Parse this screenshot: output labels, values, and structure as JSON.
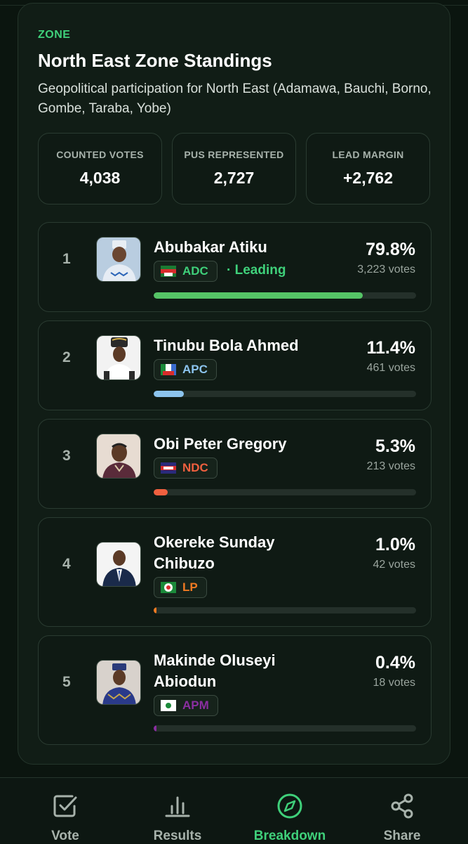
{
  "zone": {
    "tag": "ZONE",
    "title": "North East Zone Standings",
    "description": "Geopolitical participation for North East (Adamawa, Bauchi, Borno, Gombe, Taraba, Yobe)"
  },
  "stats": [
    {
      "label": "COUNTED VOTES",
      "value": "4,038"
    },
    {
      "label": "PUS REPRESENTED",
      "value": "2,727"
    },
    {
      "label": "LEAD MARGIN",
      "value": "+2,762"
    }
  ],
  "candidates": [
    {
      "rank": "1",
      "name": "Abubakar Atiku",
      "party": "ADC",
      "party_color": "#3fd07a",
      "status": "· Leading",
      "percent": "79.8%",
      "votes": "3,223 votes",
      "share": 0.798,
      "bar_color": "#55c466"
    },
    {
      "rank": "2",
      "name": "Tinubu Bola Ahmed",
      "party": "APC",
      "party_color": "#8cc4ee",
      "status": "",
      "percent": "11.4%",
      "votes": "461 votes",
      "share": 0.114,
      "bar_color": "#8cc4ee"
    },
    {
      "rank": "3",
      "name": "Obi Peter Gregory",
      "party": "NDC",
      "party_color": "#f1603f",
      "status": "",
      "percent": "5.3%",
      "votes": "213 votes",
      "share": 0.053,
      "bar_color": "#f1603f"
    },
    {
      "rank": "4",
      "name": "Okereke Sunday Chibuzo",
      "party": "LP",
      "party_color": "#f07a22",
      "status": "",
      "percent": "1.0%",
      "votes": "42 votes",
      "share": 0.01,
      "bar_color": "#f07a22"
    },
    {
      "rank": "5",
      "name": "Makinde Oluseyi Abiodun",
      "party": "APM",
      "party_color": "#8a2ea0",
      "status": "",
      "percent": "0.4%",
      "votes": "18 votes",
      "share": 0.004,
      "bar_color": "#8a2ea0"
    }
  ],
  "nav": [
    {
      "label": "Vote",
      "icon": "checkbox-icon"
    },
    {
      "label": "Results",
      "icon": "bar-chart-icon"
    },
    {
      "label": "Breakdown",
      "icon": "compass-icon",
      "active": true
    },
    {
      "label": "Share",
      "icon": "share-icon"
    }
  ],
  "colors": {
    "accent": "#3fd07a",
    "background": "#0b150f",
    "card": "#111d16"
  }
}
